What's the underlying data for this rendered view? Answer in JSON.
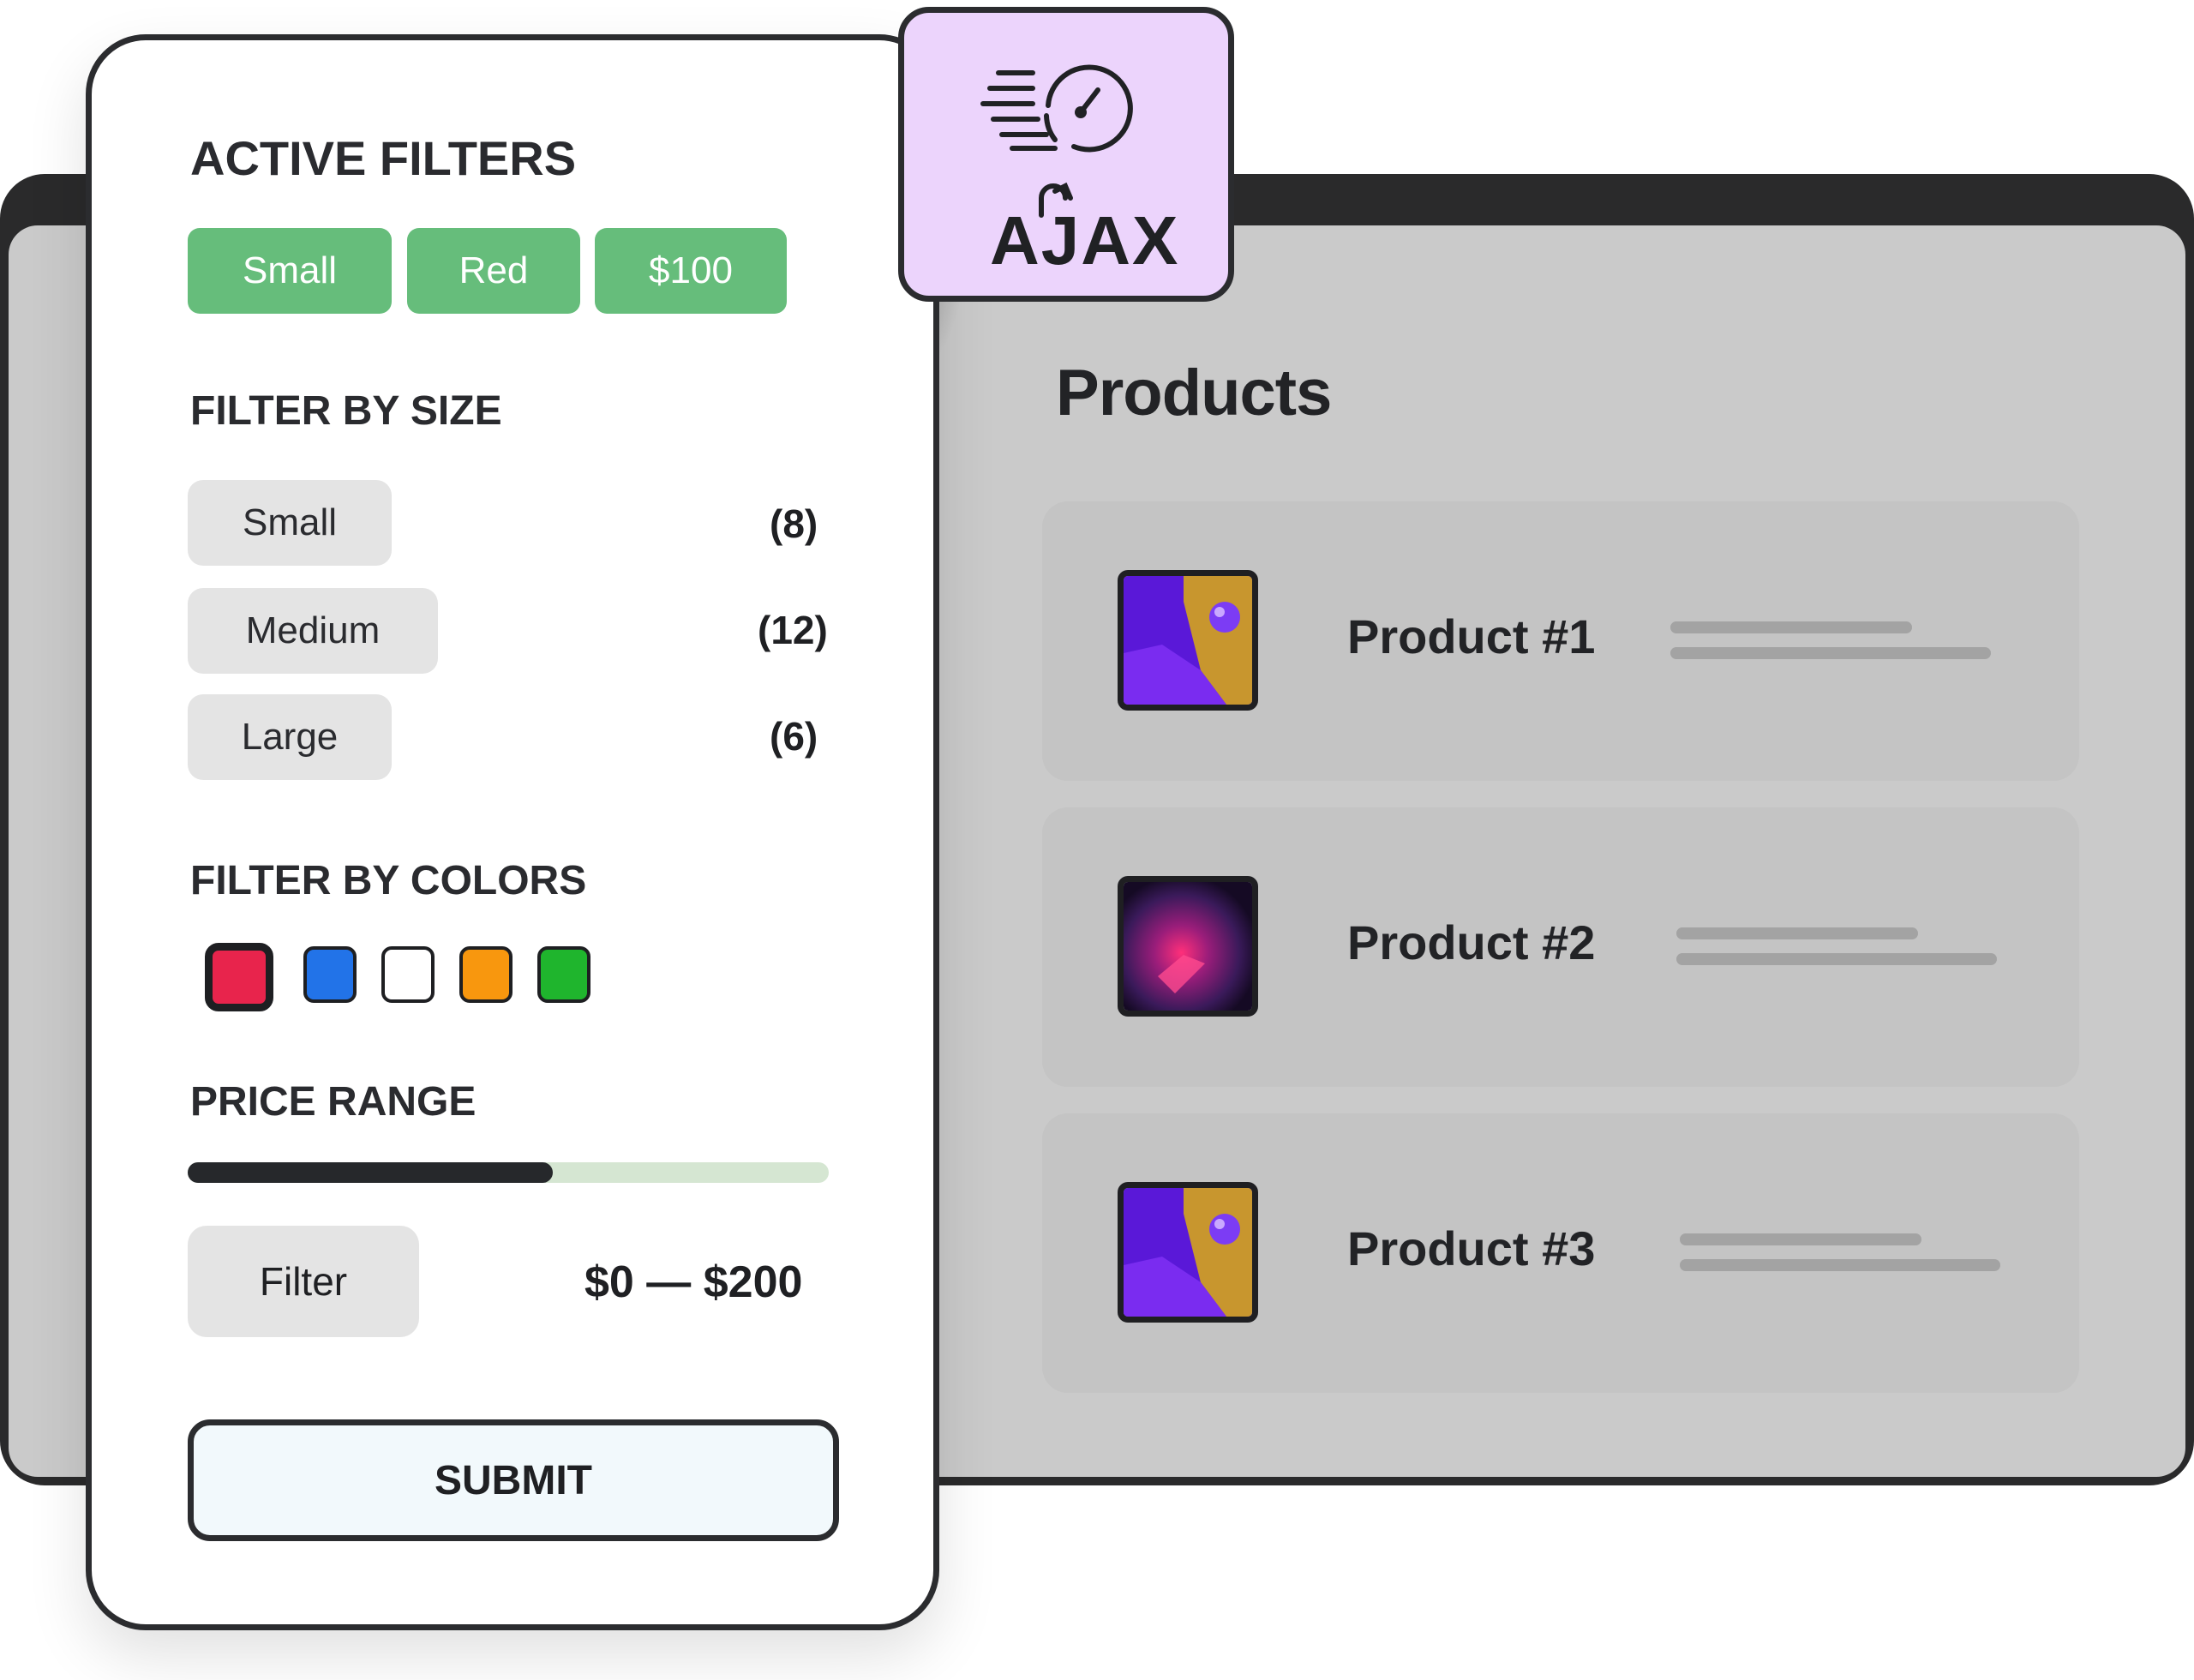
{
  "badge": {
    "text": "AJAX",
    "icon": "speedometer-icon"
  },
  "filters": {
    "active_title": "ACTIVE FILTERS",
    "active_chips": [
      "Small",
      "Red",
      "$100"
    ],
    "size_title": "FILTER BY SIZE",
    "sizes": [
      {
        "label": "Small",
        "count": "(8)"
      },
      {
        "label": "Medium",
        "count": "(12)"
      },
      {
        "label": "Large",
        "count": "(6)"
      }
    ],
    "colors_title": "FILTER BY COLORS",
    "colors": [
      "#e8244c",
      "#2273e8",
      "#ffffff",
      "#f8970e",
      "#1fb52d"
    ],
    "selected_color": "#e8244c",
    "price_title": "PRICE RANGE",
    "price_fill": 0.57,
    "filter_label": "Filter",
    "range_text": "$0 — $200",
    "submit_label": "SUBMIT"
  },
  "products": {
    "title": "Products",
    "items": [
      {
        "name": "Product #1"
      },
      {
        "name": "Product #2"
      },
      {
        "name": "Product #3"
      }
    ]
  },
  "colors": {
    "chip_green": "#66bd7b",
    "badge_purple": "#ecd4fc",
    "dark": "#2b2c2f"
  }
}
